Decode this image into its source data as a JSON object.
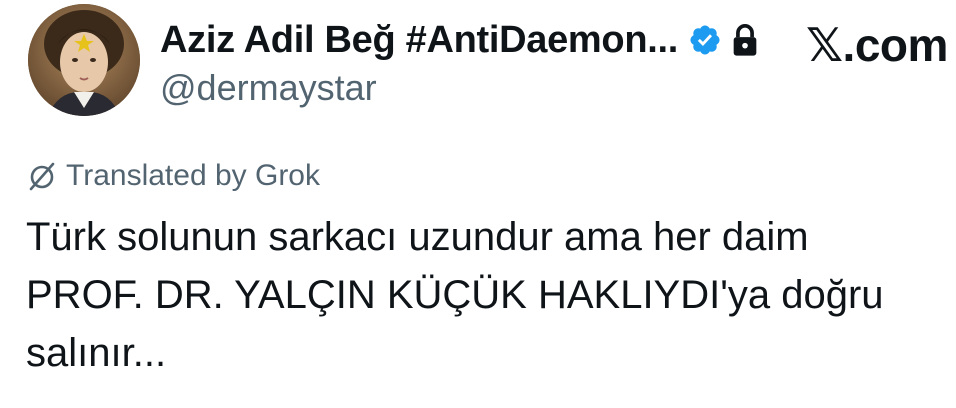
{
  "author": {
    "display_name": "Aziz Adil Beğ #AntiDaemon...",
    "handle": "@dermaystar",
    "verified_icon": "verified-badge-icon",
    "lock_icon": "lock-icon"
  },
  "site_badge": "𝕏.com",
  "translation": {
    "label": "Translated by Grok",
    "icon": "grok-icon"
  },
  "post": {
    "lines": [
      "Türk solunun sarkacı uzundur ama her daim",
      "PROF. DR. YALÇIN KÜÇÜK HAKLIYDI'ya doğru",
      "salınır..."
    ]
  },
  "colors": {
    "text": "#0f1419",
    "secondary": "#536471",
    "verified": "#1d9bf0"
  }
}
